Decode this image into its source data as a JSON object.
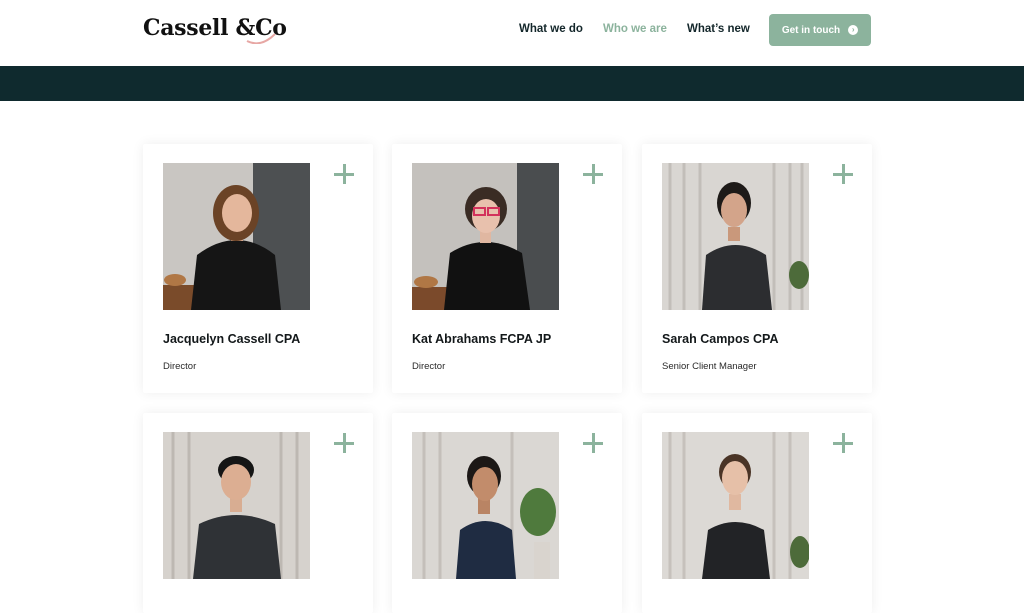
{
  "brand": {
    "name": "Cassell & Co."
  },
  "nav": {
    "items": [
      {
        "label": "What we do",
        "active": false
      },
      {
        "label": "Who we are",
        "active": true
      },
      {
        "label": "What’s new",
        "active": false
      }
    ],
    "cta_label": "Get in touch"
  },
  "colors": {
    "accent": "#8cb39d",
    "band": "#0f2a2e",
    "text": "#13262a"
  },
  "team": [
    {
      "name": "Jacquelyn Cassell CPA",
      "role": "Director"
    },
    {
      "name": "Kat Abrahams FCPA JP",
      "role": "Director"
    },
    {
      "name": "Sarah Campos CPA",
      "role": "Senior Client Manager"
    },
    {
      "name": "",
      "role": ""
    },
    {
      "name": "",
      "role": ""
    },
    {
      "name": "",
      "role": ""
    }
  ]
}
